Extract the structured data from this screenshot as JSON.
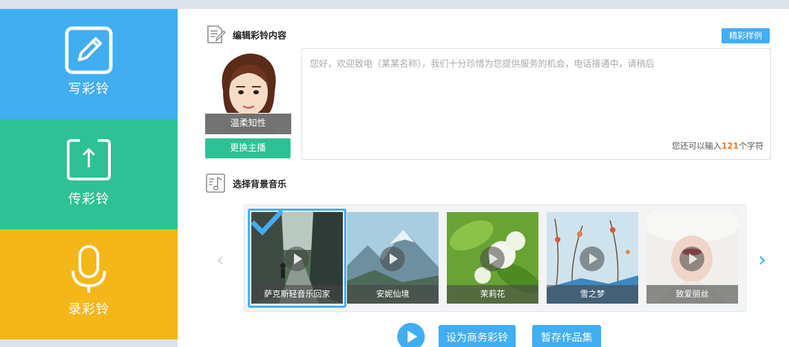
{
  "sidebar": {
    "items": [
      {
        "label": "写彩铃",
        "icon": "edit-pencil-icon",
        "color": "#41aef2"
      },
      {
        "label": "传彩铃",
        "icon": "upload-arrow-icon",
        "color": "#2ec196"
      },
      {
        "label": "录彩铃",
        "icon": "microphone-icon",
        "color": "#f4b719"
      }
    ]
  },
  "editor": {
    "section_title": "编辑彩铃内容",
    "section_icon": "document-edit-icon",
    "sample_button": "精彩样例",
    "anchor_name": "温柔知性",
    "change_anchor_button": "更换主播",
    "placeholder": "您好，欢迎致电（某某名称），我们十分珍惜为您提供服务的机会，电话接通中，请稍后",
    "counter_prefix": "您还可以输入",
    "counter_value": "121",
    "counter_suffix": "个字符"
  },
  "music": {
    "section_title": "选择背景音乐",
    "section_icon": "music-file-icon",
    "selected_index": 0,
    "tracks": [
      {
        "name": "萨克斯轻音乐回家"
      },
      {
        "name": "安妮仙境"
      },
      {
        "name": "茉莉花"
      },
      {
        "name": "雪之梦"
      },
      {
        "name": "致爱丽丝"
      }
    ]
  },
  "actions": {
    "play_icon": "play-icon",
    "set_business_button": "设为商务彩铃",
    "save_draft_button": "暂存作品集"
  },
  "colors": {
    "blue": "#41aef2",
    "green": "#2ec196",
    "yellow": "#f4b719",
    "counter_highlight": "#e87f2a"
  }
}
